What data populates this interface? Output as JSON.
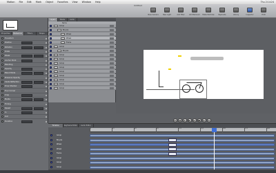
{
  "menubar": {
    "apple": "",
    "items": [
      "Motion",
      "File",
      "Edit",
      "Mark",
      "Object",
      "Favorites",
      "View",
      "Window",
      "Help"
    ],
    "clock": "Thu 2:14:24"
  },
  "window": {
    "title": "Untitled"
  },
  "toolbar": {
    "buttons": [
      {
        "label": "New Camera",
        "icon": "camera-icon"
      },
      {
        "label": "New Light",
        "icon": "light-icon"
      },
      {
        "label": "Add Filter",
        "icon": "filter-icon"
      },
      {
        "label": "Add Behavior",
        "icon": "behavior-icon"
      },
      {
        "label": "Make Particles",
        "icon": "particles-icon"
      },
      {
        "label": "Replicate",
        "icon": "replicate-icon"
      },
      {
        "label": "Library",
        "icon": "library-icon"
      },
      {
        "label": "Inspector",
        "icon": "inspector-icon"
      },
      {
        "label": "HUD",
        "icon": "hud-icon"
      }
    ]
  },
  "left_panel": {
    "tabs": [
      "Properties",
      "Behaviors",
      "Filters",
      "Shape"
    ],
    "active_tab": "Behaviors",
    "rows": [
      "Transform",
      "Position",
      "Rotation",
      "Scale",
      "Shear",
      "Anchor Point",
      "Blending",
      "Opacity",
      "Blend Mode",
      "Preserve Opacity",
      "Casts Reflection",
      "Drop Shadow",
      "Four Corner",
      "Crop",
      "Media",
      "Timing",
      "Speed",
      "In",
      "Out",
      "Duration",
      "End Condition"
    ]
  },
  "layers_panel": {
    "tabs": [
      "Layers",
      "Media",
      "Audio"
    ],
    "active_tab": "Layers",
    "header": "Name",
    "rows": [
      {
        "name": "Group",
        "indent": 0,
        "selected": false
      },
      {
        "name": "Bicycle",
        "indent": 1,
        "selected": false
      },
      {
        "name": "Wheel",
        "indent": 2,
        "selected": false
      },
      {
        "name": "Wheel",
        "indent": 2,
        "selected": true
      },
      {
        "name": "Frame",
        "indent": 2,
        "selected": false
      },
      {
        "name": "Group",
        "indent": 0,
        "selected": false
      },
      {
        "name": "Bicycle",
        "indent": 1,
        "selected": false
      },
      {
        "name": "Group",
        "indent": 0,
        "selected": false
      },
      {
        "name": "Group",
        "indent": 0,
        "selected": false
      },
      {
        "name": "Group",
        "indent": 0,
        "selected": false
      },
      {
        "name": "Group",
        "indent": 0,
        "selected": false
      },
      {
        "name": "Group",
        "indent": 0,
        "selected": false
      },
      {
        "name": "Group",
        "indent": 0,
        "selected": false
      },
      {
        "name": "Group",
        "indent": 0,
        "selected": false
      },
      {
        "name": "Group",
        "indent": 0,
        "selected": false
      },
      {
        "name": "Group",
        "indent": 0,
        "selected": false
      }
    ]
  },
  "transport": [
    "⏮",
    "◀",
    "⏵",
    "▶",
    "⏭",
    "●",
    "⏺",
    "⟲"
  ],
  "timeline": {
    "tabs": [
      "Timeline",
      "Keyframe Editor",
      "Audio Editor"
    ],
    "active_tab": "Timeline",
    "ticks": [
      "1",
      "31",
      "61",
      "91",
      "121",
      "151",
      "181",
      "211",
      "241"
    ],
    "rows": [
      {
        "name": "Group",
        "bar_start": 0,
        "bar_end": 1,
        "selected": false
      },
      {
        "name": "Bicycle",
        "bar_start": 0,
        "bar_end": 1,
        "selected": false
      },
      {
        "name": "Wheel",
        "bar_start": 0,
        "bar_end": 1,
        "selected": true
      },
      {
        "name": "Wheel",
        "bar_start": 0,
        "bar_end": 1,
        "selected": false
      },
      {
        "name": "Frame",
        "bar_start": 0,
        "bar_end": 1,
        "selected": false
      },
      {
        "name": "Group",
        "bar_start": 0,
        "bar_end": 1,
        "selected": false
      },
      {
        "name": "Group",
        "bar_start": 0,
        "bar_end": 1,
        "selected": false
      },
      {
        "name": "Group",
        "bar_start": 0,
        "bar_end": 1,
        "selected": false
      }
    ]
  },
  "colors": {
    "accent": "#3a6fd0",
    "canvas": "#ffffff",
    "yellow": "#f0d000"
  }
}
